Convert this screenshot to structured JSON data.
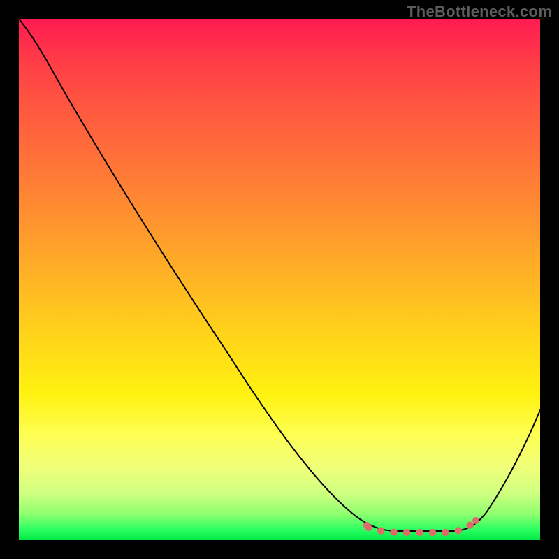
{
  "watermark": "TheBottleneck.com",
  "chart_data": {
    "type": "line",
    "title": "",
    "xlabel": "",
    "ylabel": "",
    "x": [
      0.0,
      0.04,
      0.1,
      0.2,
      0.3,
      0.4,
      0.5,
      0.58,
      0.63,
      0.67,
      0.7,
      0.73,
      0.78,
      0.83,
      0.87,
      0.9,
      0.94,
      1.0
    ],
    "values": [
      1.0,
      0.96,
      0.88,
      0.74,
      0.6,
      0.46,
      0.32,
      0.2,
      0.12,
      0.06,
      0.03,
      0.02,
      0.02,
      0.02,
      0.03,
      0.06,
      0.12,
      0.27
    ],
    "ylim": [
      0,
      1
    ],
    "xlim": [
      0,
      1
    ],
    "highlight_segment": {
      "x_start": 0.68,
      "x_end": 0.87,
      "y": 0.02,
      "color": "#e06a6a"
    },
    "background_gradient": [
      "#ff1a52",
      "#ff7a36",
      "#ffd21a",
      "#fdff55",
      "#00e845"
    ]
  }
}
